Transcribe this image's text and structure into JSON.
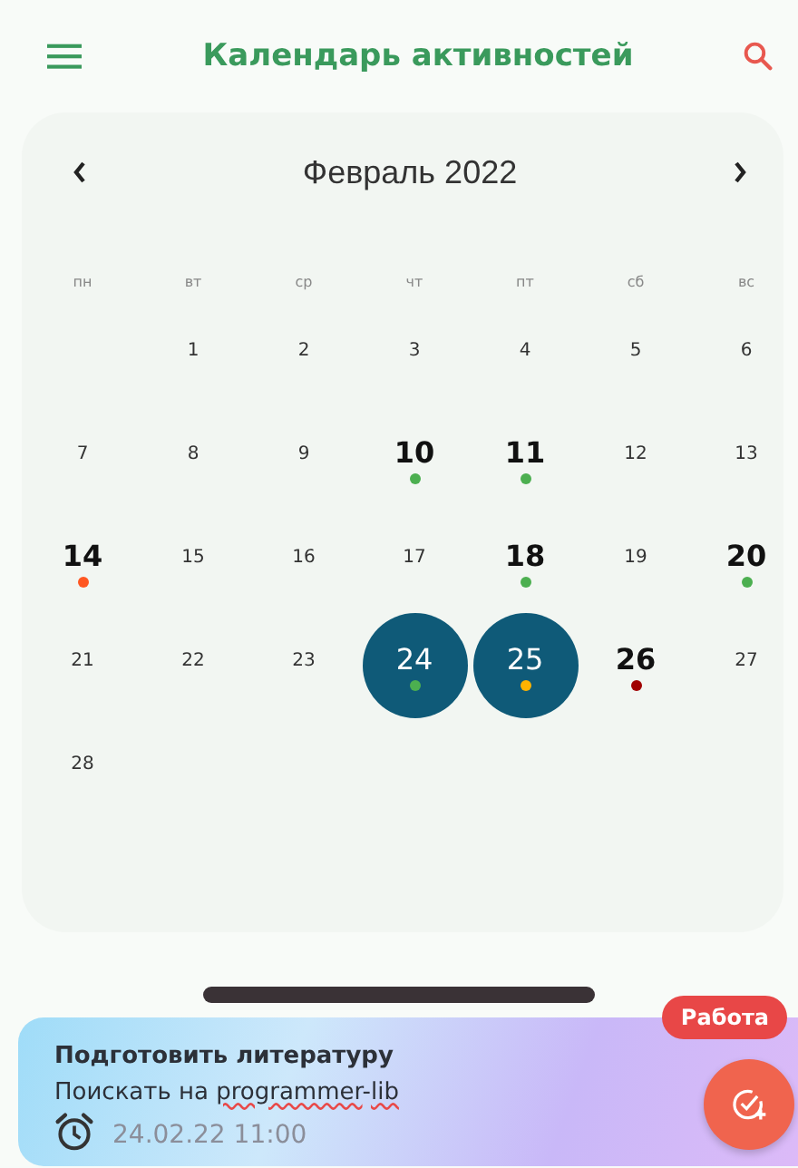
{
  "app_bar": {
    "title": "Календарь активностей"
  },
  "calendar": {
    "month_title": "Февраль 2022",
    "weekdays": [
      "пн",
      "вт",
      "ср",
      "чт",
      "пт",
      "сб",
      "вс"
    ],
    "days": [
      {
        "kind": "blank"
      },
      {
        "kind": "day",
        "label": "1",
        "selected": false
      },
      {
        "kind": "day",
        "label": "2",
        "selected": false
      },
      {
        "kind": "day",
        "label": "3",
        "selected": false
      },
      {
        "kind": "day",
        "label": "4",
        "selected": false
      },
      {
        "kind": "day",
        "label": "5",
        "selected": false
      },
      {
        "kind": "day",
        "label": "6",
        "selected": false
      },
      {
        "kind": "day",
        "label": "7",
        "selected": false
      },
      {
        "kind": "day",
        "label": "8",
        "selected": false
      },
      {
        "kind": "day",
        "label": "9",
        "selected": false
      },
      {
        "kind": "day",
        "label": "10",
        "selected": false,
        "color": "#4caf50"
      },
      {
        "kind": "day",
        "label": "11",
        "selected": false,
        "color": "#4caf50"
      },
      {
        "kind": "day",
        "label": "12",
        "selected": false
      },
      {
        "kind": "day",
        "label": "13",
        "selected": false
      },
      {
        "kind": "day",
        "label": "14",
        "selected": false,
        "color": "#ff5722"
      },
      {
        "kind": "day",
        "label": "15",
        "selected": false
      },
      {
        "kind": "day",
        "label": "16",
        "selected": false
      },
      {
        "kind": "day",
        "label": "17",
        "selected": false
      },
      {
        "kind": "day",
        "label": "18",
        "selected": false,
        "color": "#4caf50"
      },
      {
        "kind": "day",
        "label": "19",
        "selected": false
      },
      {
        "kind": "day",
        "label": "20",
        "selected": false,
        "color": "#4caf50"
      },
      {
        "kind": "day",
        "label": "21",
        "selected": false
      },
      {
        "kind": "day",
        "label": "22",
        "selected": false
      },
      {
        "kind": "day",
        "label": "23",
        "selected": false
      },
      {
        "kind": "day",
        "label": "24",
        "selected": true,
        "color": "#4caf50"
      },
      {
        "kind": "day",
        "label": "25",
        "selected": true,
        "color": "#ffb300"
      },
      {
        "kind": "day",
        "label": "26",
        "selected": false,
        "color": "#a00000"
      },
      {
        "kind": "day",
        "label": "27",
        "selected": false
      },
      {
        "kind": "day",
        "label": "28",
        "selected": false
      }
    ]
  },
  "task": {
    "title": "Подготовить литературу",
    "note": [
      {
        "text": "Поискать на ",
        "misspelled": false
      },
      {
        "text": "programmer",
        "misspelled": true
      },
      {
        "text": "-",
        "misspelled": false
      },
      {
        "text": "lib",
        "misspelled": true
      }
    ],
    "tag": "Работа",
    "time": "24.02.22 11:00"
  }
}
